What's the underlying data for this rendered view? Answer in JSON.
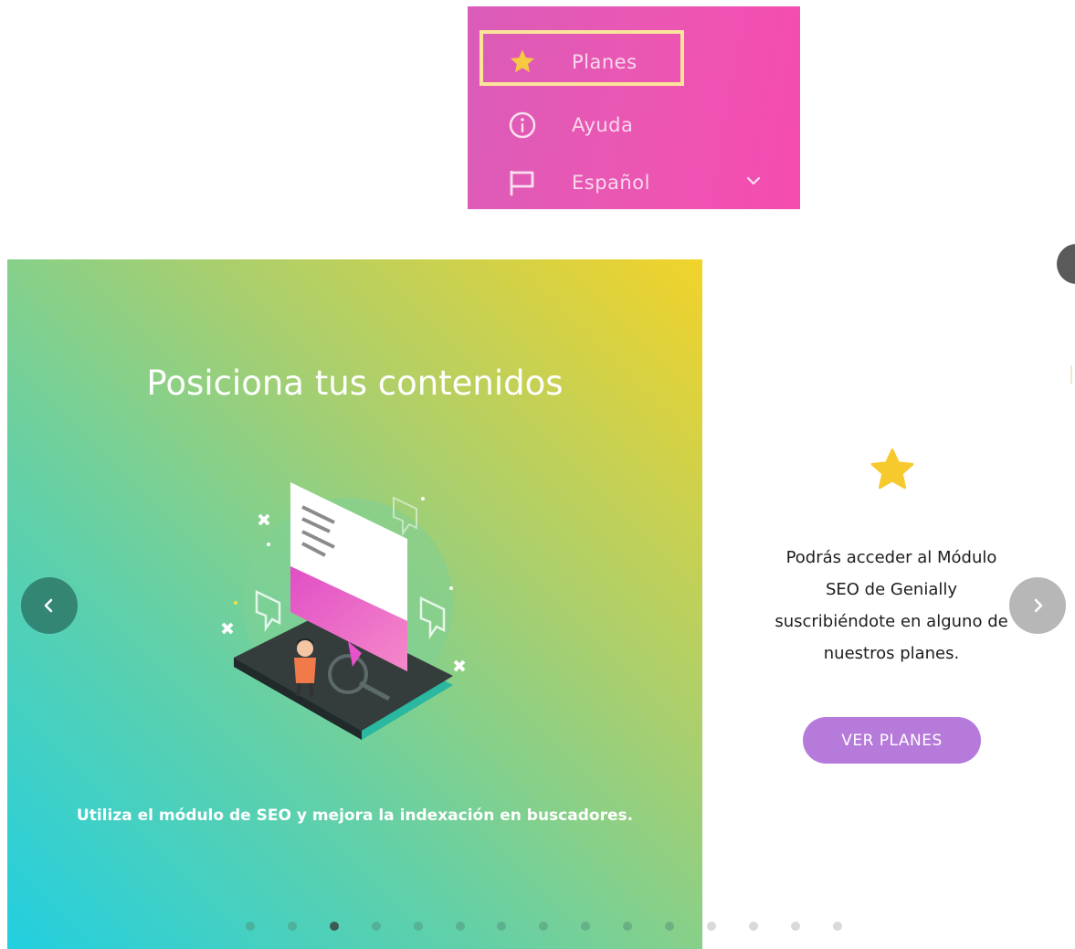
{
  "menu": {
    "items": [
      {
        "label": "Planes",
        "icon": "star-icon"
      },
      {
        "label": "Ayuda",
        "icon": "info-icon"
      },
      {
        "label": "Español",
        "icon": "flag-icon"
      }
    ],
    "highlight_color": "#fbe49a",
    "background_color": "#ea57b3"
  },
  "slide": {
    "title": "Posiciona tus contenidos",
    "subtitle": "Utiliza el módulo de SEO y mejora la indexación en buscadores."
  },
  "side_panel": {
    "text_lines": [
      "Podrás acceder al Módulo",
      "SEO de Genially",
      "suscribiéndote en alguno de",
      "nuestros planes."
    ],
    "button_label": "VER PLANES",
    "button_color": "#b57ada",
    "star_color": "#f6c92c"
  },
  "pagination": {
    "total": 15,
    "active_index": 2
  }
}
